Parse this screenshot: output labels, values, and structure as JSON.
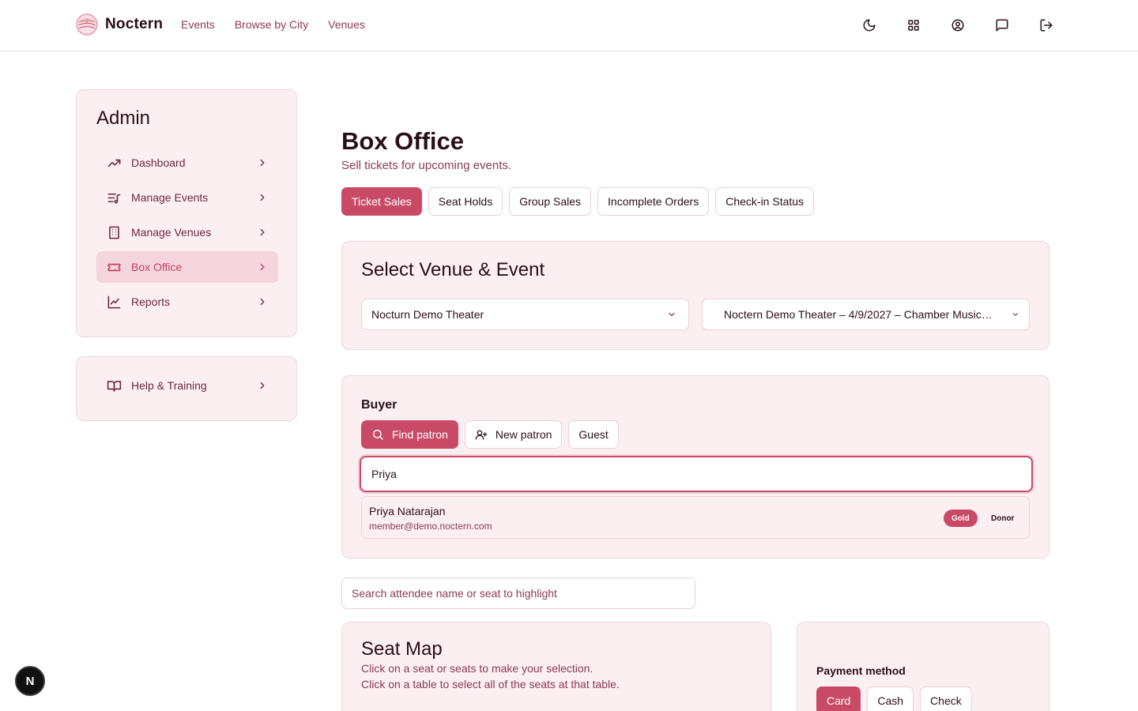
{
  "brand": {
    "name": "Noctern"
  },
  "nav": [
    "Events",
    "Browse by City",
    "Venues"
  ],
  "top_icons": [
    "moon-icon",
    "grid-icon",
    "user-circle-icon",
    "message-icon",
    "logout-icon"
  ],
  "sidebar": {
    "title": "Admin",
    "items": [
      {
        "label": "Dashboard",
        "icon": "trending-up-icon"
      },
      {
        "label": "Manage Events",
        "icon": "list-music-icon"
      },
      {
        "label": "Manage Venues",
        "icon": "building-icon"
      },
      {
        "label": "Box Office",
        "icon": "ticket-icon",
        "active": true
      },
      {
        "label": "Reports",
        "icon": "line-chart-icon"
      }
    ],
    "help": {
      "label": "Help & Training",
      "icon": "book-open-icon"
    }
  },
  "page": {
    "title": "Box Office",
    "subtitle": "Sell tickets for upcoming events."
  },
  "tabs": [
    {
      "label": "Ticket Sales",
      "active": true
    },
    {
      "label": "Seat Holds"
    },
    {
      "label": "Group Sales"
    },
    {
      "label": "Incomplete Orders"
    },
    {
      "label": "Check-in Status"
    }
  ],
  "venue_panel": {
    "title": "Select Venue & Event",
    "venue_value": "Nocturn Demo Theater",
    "event_value": "Noctern Demo Theater – 4/9/2027 – Chamber Music…"
  },
  "buyer": {
    "title": "Buyer",
    "buttons": [
      "Find patron",
      "New patron",
      "Guest"
    ],
    "search_value": "Priya",
    "result": {
      "name": "Priya Natarajan",
      "email": "member@demo.noctern.com",
      "badges": [
        "Gold",
        "Donor"
      ]
    }
  },
  "attendee_search": {
    "placeholder": "Search attendee name or seat to highlight"
  },
  "seat_map": {
    "title": "Seat Map",
    "line1": "Click on a seat or seats to make your selection.",
    "line2": "Click on a table to select all of the seats at that table."
  },
  "payment": {
    "title": "Payment method",
    "options": [
      {
        "label": "Card",
        "active": true
      },
      {
        "label": "Cash"
      },
      {
        "label": "Check"
      }
    ]
  },
  "fab": {
    "label": "N"
  },
  "colors": {
    "accent": "#c94a67",
    "panel_bg": "#fbeff1",
    "text_muted": "#8a3b54"
  }
}
